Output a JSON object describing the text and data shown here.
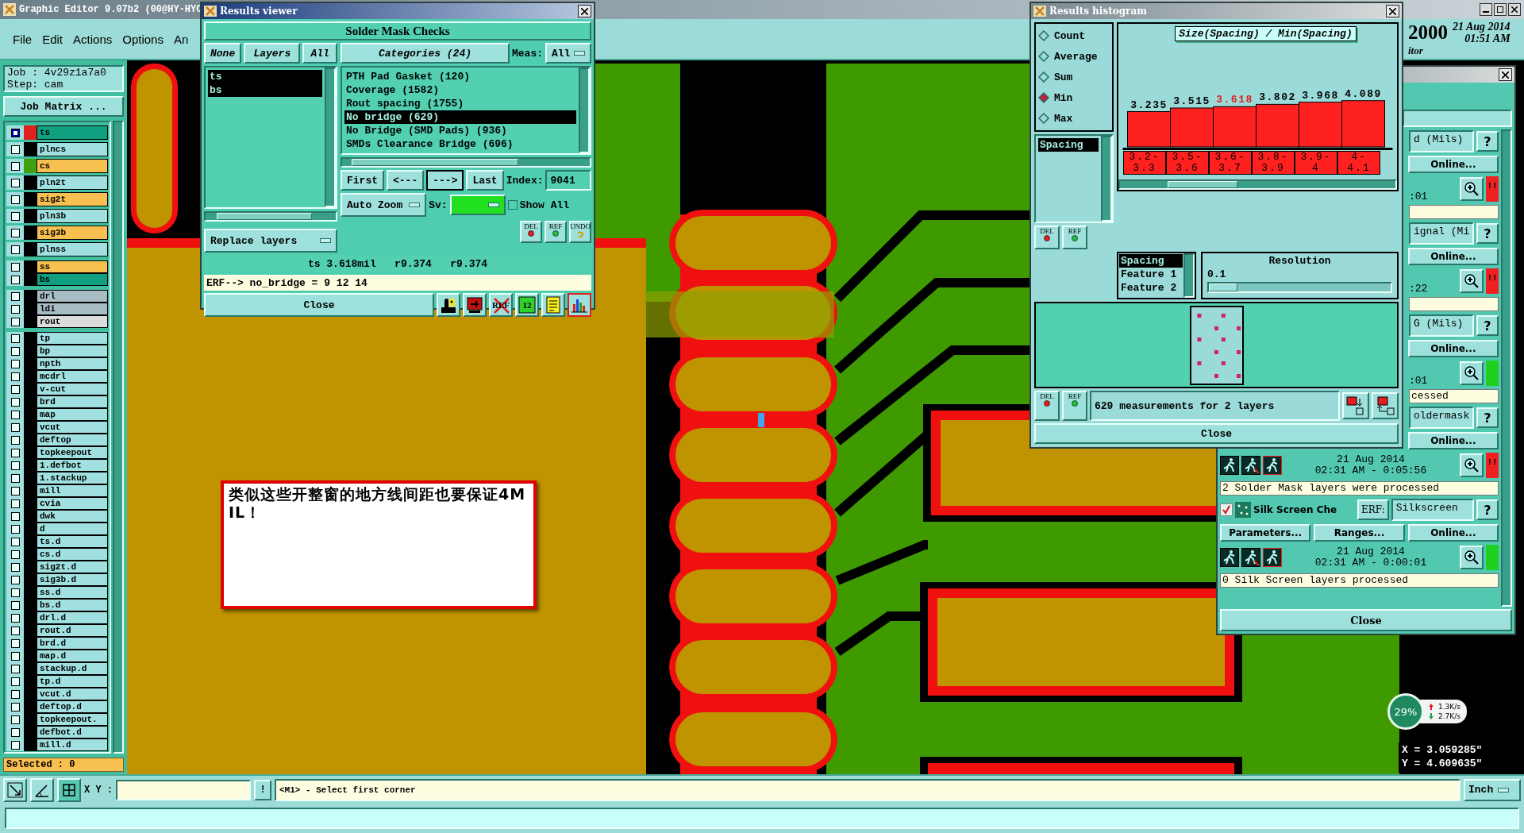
{
  "main_window": {
    "title": "Graphic Editor 9.07b2 (00@HY-HYC",
    "menu": [
      "File",
      "Edit",
      "Actions",
      "Options",
      "An"
    ],
    "banner": {
      "number": "2000",
      "date": "21 Aug 2014",
      "time": "01:51 AM",
      "caption": "itor"
    }
  },
  "job_panel": {
    "job": "Job : 4v29z1a7a0",
    "step": "Step: cam",
    "matrix_button": "Job Matrix ...",
    "layer_groups": [
      {
        "items": [
          {
            "name": "ts",
            "color": "#10a080",
            "shown": {
              "color": "#e02020"
            },
            "selected": true
          },
          {
            "name": "plncs",
            "color": "#a0e0e0",
            "selected": false
          },
          {
            "name": "cs",
            "color": "#f8c050",
            "shown": {
              "color": "#40a010"
            },
            "selected": false
          },
          {
            "name": "pln2t",
            "color": "#a0e0e0",
            "selected": false
          },
          {
            "name": "sig2t",
            "color": "#f8c050",
            "selected": false
          },
          {
            "name": "pln3b",
            "color": "#a0e0e0",
            "selected": false
          },
          {
            "name": "sig3b",
            "color": "#f8c050",
            "selected": false
          },
          {
            "name": "plnss",
            "color": "#a0e0e0",
            "selected": false
          }
        ]
      },
      {
        "items": [
          {
            "name": "ss",
            "color": "#f8c050",
            "selected": false
          },
          {
            "name": "bs",
            "color": "#10a080",
            "selected": false
          }
        ]
      },
      {
        "items": [
          {
            "name": "drl",
            "color": "#a8bcc4",
            "selected": false
          },
          {
            "name": "ldi",
            "color": "#a8bcc4",
            "selected": false
          },
          {
            "name": "rout",
            "color": "#dcdcdc",
            "selected": false
          }
        ]
      },
      {
        "items": [
          {
            "name": "tp",
            "color": "#a0e0e0",
            "selected": false
          },
          {
            "name": "bp",
            "color": "#a0e0e0",
            "selected": false
          },
          {
            "name": "npth",
            "color": "#a0e0e0",
            "selected": false
          },
          {
            "name": "mcdrl",
            "color": "#a0e0e0",
            "selected": false
          },
          {
            "name": "v-cut",
            "color": "#a0e0e0",
            "selected": false
          },
          {
            "name": "brd",
            "color": "#a0e0e0",
            "selected": false
          },
          {
            "name": "map",
            "color": "#a0e0e0",
            "selected": false
          },
          {
            "name": "vcut",
            "color": "#a0e0e0",
            "selected": false
          },
          {
            "name": "deftop",
            "color": "#a0e0e0",
            "selected": false
          },
          {
            "name": "topkeepout",
            "color": "#a0e0e0",
            "selected": false
          },
          {
            "name": "1.defbot",
            "color": "#a0e0e0",
            "selected": false
          },
          {
            "name": "1.stackup",
            "color": "#a0e0e0",
            "selected": false
          },
          {
            "name": "mill",
            "color": "#a0e0e0",
            "selected": false
          },
          {
            "name": "cvia",
            "color": "#a0e0e0",
            "selected": false
          },
          {
            "name": "dwk",
            "color": "#a0e0e0",
            "selected": false
          },
          {
            "name": "d",
            "color": "#a0e0e0",
            "selected": false
          },
          {
            "name": "ts.d",
            "color": "#a0e0e0",
            "selected": false
          },
          {
            "name": "cs.d",
            "color": "#a0e0e0",
            "selected": false
          },
          {
            "name": "sig2t.d",
            "color": "#a0e0e0",
            "selected": false
          },
          {
            "name": "sig3b.d",
            "color": "#a0e0e0",
            "selected": false
          },
          {
            "name": "ss.d",
            "color": "#a0e0e0",
            "selected": false
          },
          {
            "name": "bs.d",
            "color": "#a0e0e0",
            "selected": false
          },
          {
            "name": "drl.d",
            "color": "#a0e0e0",
            "selected": false
          },
          {
            "name": "rout.d",
            "color": "#a0e0e0",
            "selected": false
          },
          {
            "name": "brd.d",
            "color": "#a0e0e0",
            "selected": false
          },
          {
            "name": "map.d",
            "color": "#a0e0e0",
            "selected": false
          },
          {
            "name": "stackup.d",
            "color": "#a0e0e0",
            "selected": false
          },
          {
            "name": "tp.d",
            "color": "#a0e0e0",
            "selected": false
          },
          {
            "name": "vcut.d",
            "color": "#a0e0e0",
            "selected": false
          },
          {
            "name": "deftop.d",
            "color": "#a0e0e0",
            "selected": false
          },
          {
            "name": "topkeepout.",
            "color": "#a0e0e0",
            "selected": false
          },
          {
            "name": "defbot.d",
            "color": "#a0e0e0",
            "selected": false
          },
          {
            "name": "mill.d",
            "color": "#a0e0e0",
            "selected": false
          }
        ]
      }
    ],
    "selected_count": "Selected : 0"
  },
  "annotation": {
    "text": "类似这些开整窗的地方线间距也要保证4MIL！"
  },
  "coordinates": {
    "x": "X = 3.059285\"",
    "y": "Y = 4.609635\""
  },
  "network": {
    "usage": "29%",
    "upload": "1.3K/s",
    "download": "2.7K/s"
  },
  "command_bar": {
    "xy_label": "X Y :",
    "bang": "!",
    "prompt": "<M1> - Select first corner",
    "units": "Inch"
  },
  "results_viewer": {
    "title": "Results viewer",
    "heading": "Solder Mask Checks",
    "layer_buttons": [
      "None",
      "Layers",
      "All"
    ],
    "layers": [
      {
        "name": "ts",
        "selected": true
      },
      {
        "name": "bs",
        "selected": true
      }
    ],
    "replace": "Replace layers",
    "categories_button": "Categories (24)",
    "meas_label": "Meas:",
    "meas_value": "All",
    "categories": [
      {
        "label": "PTH Pad Gasket (120)",
        "selected": false
      },
      {
        "label": "Coverage (1582)",
        "selected": false
      },
      {
        "label": "Rout spacing (1755)",
        "selected": false
      },
      {
        "label": "No bridge (629)",
        "selected": true
      },
      {
        "label": "No Bridge (SMD Pads) (936)",
        "selected": false
      },
      {
        "label": "SMDs Clearance Bridge (696)",
        "selected": false
      }
    ],
    "nav": [
      {
        "label": "First",
        "selected": false
      },
      {
        "label": "<---",
        "selected": false
      },
      {
        "label": "--->",
        "selected": true
      },
      {
        "label": "Last",
        "selected": false
      }
    ],
    "index_label": "Index:",
    "index_value": "9041",
    "zoom_mode": "Auto Zoom",
    "sv_label": "Sv:",
    "show_all": {
      "label": "Show All",
      "checked": false
    },
    "edit_buttons": [
      "DEL",
      "REF",
      "UNDO"
    ],
    "measurement": "ts 3.618mil   r9.374   r9.374",
    "erf": "ERF--> no_bridge = 9 12 14",
    "close": "Close",
    "tools": [
      {
        "kind": "figure",
        "selected": false
      },
      {
        "kind": "screen",
        "selected": false
      },
      {
        "kind": "crossed",
        "label": "REF",
        "selected": false
      },
      {
        "kind": "number",
        "label": "12",
        "selected": false
      },
      {
        "kind": "notes",
        "selected": false
      },
      {
        "kind": "chart",
        "selected": true
      }
    ]
  },
  "histogram": {
    "title": "Results histogram",
    "modes": [
      {
        "label": "Count",
        "selected": false
      },
      {
        "label": "Average",
        "selected": false
      },
      {
        "label": "Sum",
        "selected": false
      },
      {
        "label": "Min",
        "selected": true
      },
      {
        "label": "Max",
        "selected": false
      }
    ],
    "fields": [
      {
        "label": "Spacing",
        "selected": true
      }
    ],
    "list_buttons": [
      "DEL",
      "REF"
    ],
    "chart_data": {
      "type": "bar",
      "title": "Size(Spacing) / Min(Spacing)",
      "categories": [
        "3.2-3.3",
        "3.5-3.6",
        "3.6-3.7",
        "3.8-3.9",
        "3.9-4",
        "4-4.1"
      ],
      "values": [
        3.235,
        3.515,
        3.618,
        3.802,
        3.968,
        4.089
      ],
      "data_labels": true
    },
    "bars": [
      {
        "selected": false
      },
      {
        "selected": false
      },
      {
        "selected": true
      },
      {
        "selected": false
      },
      {
        "selected": false
      },
      {
        "selected": false
      }
    ],
    "attributes": [
      {
        "label": "Spacing",
        "selected": true
      },
      {
        "label": "Feature 1",
        "selected": false
      },
      {
        "label": "Feature 2",
        "selected": false
      }
    ],
    "resolution": {
      "label": "Resolution",
      "value": "0.1",
      "level": 0
    },
    "summary_buttons": [
      "DEL",
      "REF"
    ],
    "summary": "629 measurements for 2 layers",
    "close": "Close"
  },
  "checks_panel": {
    "checks": [
      {
        "name": "d (Mils)",
        "help": "?",
        "online": "Online...",
        "time": ":01",
        "alert": "!!",
        "color": "#f02020"
      },
      {
        "name": "ignal (Mi",
        "help": "?",
        "online": "Online...",
        "time": ":22",
        "alert": "!!",
        "color": "#f02020"
      },
      {
        "name": "G (Mils)",
        "help": "?",
        "online": "Online...",
        "time": ":01",
        "color": "#20d020",
        "message": "cessed"
      },
      {
        "name": "oldermask",
        "help": "?",
        "online": "Online...",
        "date": "21 Aug 2014",
        "time": "02:31 AM - 0:05:56",
        "alert": "!!",
        "color": "#f02020",
        "message": "2 Solder Mask layers were processed"
      },
      {
        "checked": true,
        "title": "Silk Screen Che",
        "erf": "ERF:",
        "name": "Silkscreen",
        "help": "?",
        "parameters": "Parameters...",
        "ranges": "Ranges...",
        "online": "Online...",
        "date": "21 Aug 2014",
        "time": "02:31 AM - 0:00:01",
        "color": "#20d020",
        "message": "0 Silk Screen layers processed"
      }
    ],
    "close": "Close"
  }
}
